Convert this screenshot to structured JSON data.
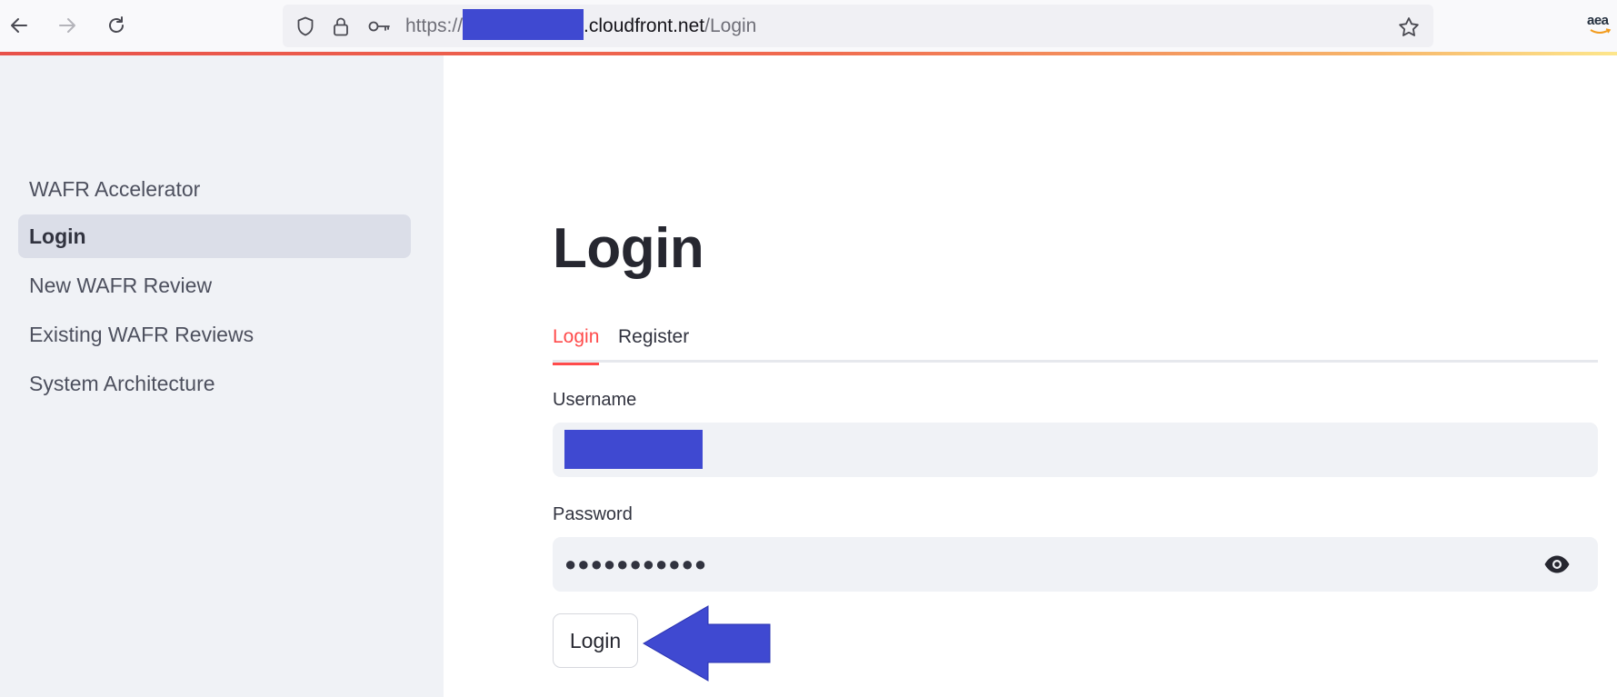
{
  "browser": {
    "url_prefix": "https://",
    "url_domain": ".cloudfront.net",
    "url_path": "/Login",
    "extension_label": "aea"
  },
  "sidebar": {
    "items": [
      {
        "label": "WAFR Accelerator",
        "active": false
      },
      {
        "label": "Login",
        "active": true
      },
      {
        "label": "New WAFR Review",
        "active": false
      },
      {
        "label": "Existing WAFR Reviews",
        "active": false
      },
      {
        "label": "System Architecture",
        "active": false
      }
    ]
  },
  "main": {
    "title": "Login",
    "tabs": [
      {
        "label": "Login",
        "active": true
      },
      {
        "label": "Register",
        "active": false
      }
    ],
    "username_label": "Username",
    "password_label": "Password",
    "password_value": "●●●●●●●●●●●",
    "login_button": "Login"
  },
  "colors": {
    "accent": "#ff4b4b",
    "redaction": "#3f49d1",
    "sidebar_bg": "#f0f2f6"
  }
}
